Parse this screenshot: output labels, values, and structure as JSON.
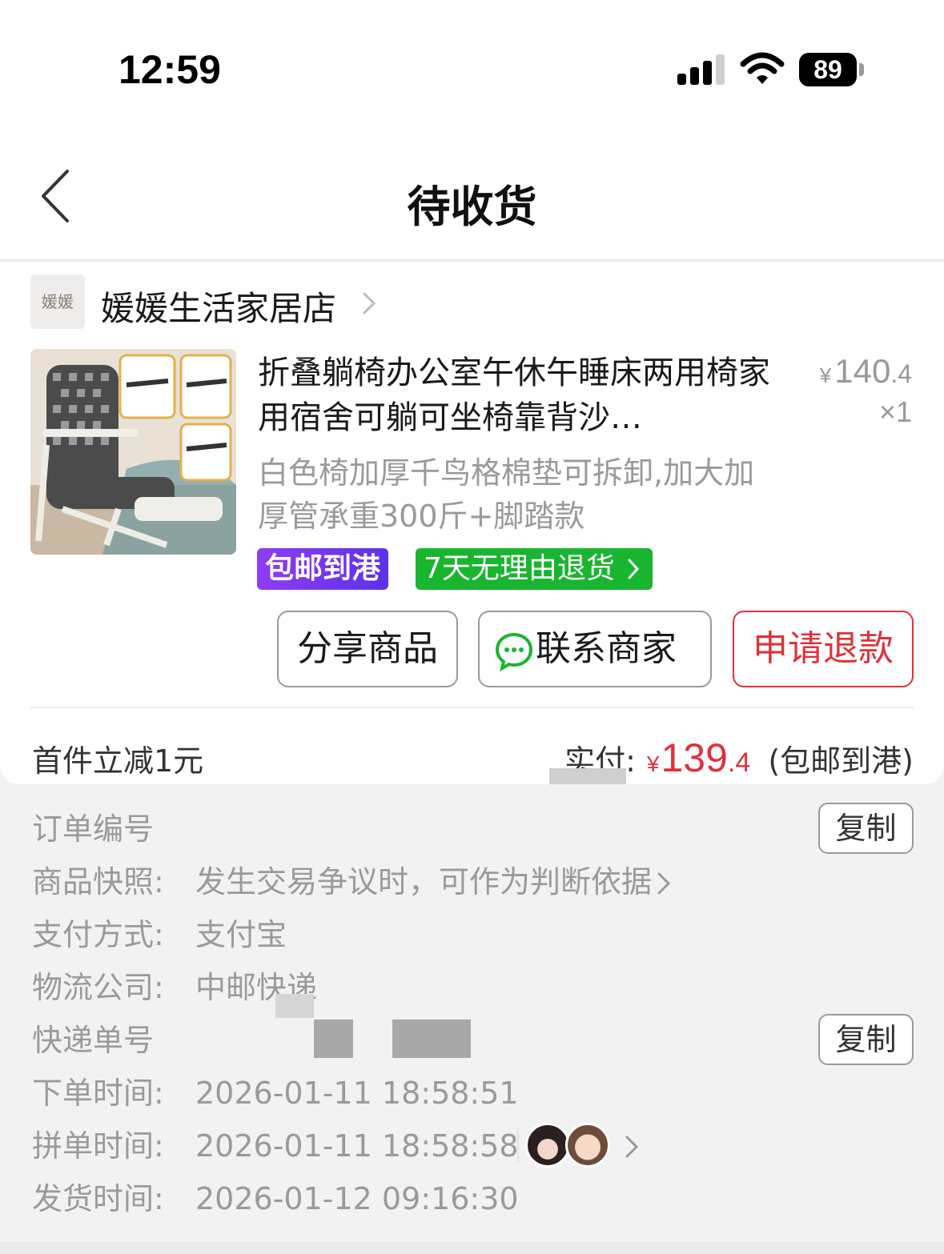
{
  "status_bar": {
    "time": "12:59",
    "battery": "89",
    "icons": [
      "signal-icon",
      "wifi-icon",
      "battery-icon"
    ]
  },
  "nav": {
    "title": "待收货",
    "back_icon": "back-chevron-icon"
  },
  "shop": {
    "logo_text": "媛媛",
    "name": "媛媛生活家居店"
  },
  "product": {
    "title": "折叠躺椅办公室午休午睡床两用椅家用宿舍可躺可坐椅靠背沙…",
    "price_symbol": "¥",
    "price_int": "140",
    "price_dec": ".4",
    "quantity": "×1",
    "spec": "白色椅加厚千鸟格棉垫可拆卸,加大加厚管承重300斤+脚踏款",
    "tags": {
      "free_shipping": "包邮到港",
      "returns": "7天无理由退货"
    }
  },
  "actions": {
    "share": "分享商品",
    "contact": "联系商家",
    "refund": "申请退款"
  },
  "summary": {
    "discount": "首件立减1元",
    "paid_label": "实付:",
    "paid_symbol": "¥",
    "paid_int": "139",
    "paid_dec": ".4",
    "paid_note": "(包邮到港)"
  },
  "order_info": {
    "order_no_label": "订单编号",
    "copy_label": "复制",
    "snapshot_label": "商品快照:",
    "snapshot_value": "发生交易争议时，可作为判断依据",
    "payment_label": "支付方式:",
    "payment_value": "支付宝",
    "logistics_label": "物流公司:",
    "logistics_value": "中邮快递",
    "tracking_label": "快递单号",
    "order_time_label": "下单时间:",
    "order_time_value": "2026-01-11 18:58:51",
    "group_time_label": "拼单时间:",
    "group_time_value": "2026-01-11 18:58:58",
    "ship_time_label": "发货时间:",
    "ship_time_value": "2026-01-12 09:16:30"
  },
  "colors": {
    "accent_red": "#e0313a",
    "green_tag": "#19b52f",
    "purple_tag": "#6b35ee",
    "muted": "#9a9a9a"
  }
}
